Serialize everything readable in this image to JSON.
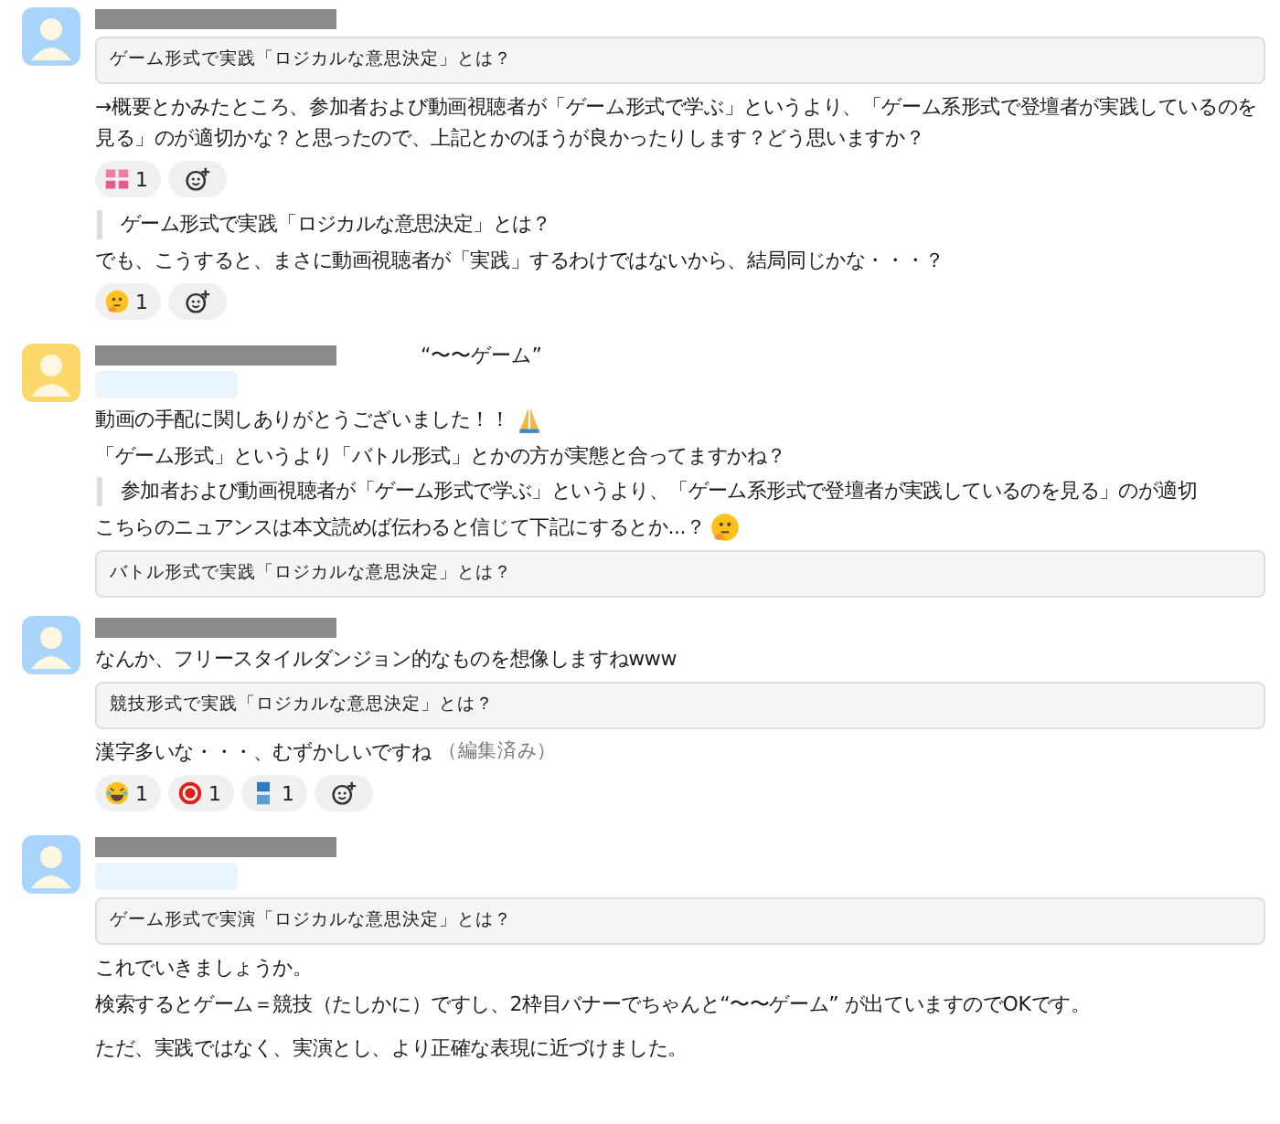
{
  "messages": [
    {
      "blocks": [
        {
          "kind": "card",
          "text": "ゲーム形式で実践「ロジカルな意思決定」とは？"
        },
        {
          "kind": "text",
          "text": "→概要とかみたところ、参加者および動画視聴者が「ゲーム形式で学ぶ」というより、「ゲーム系形式で登壇者が実践しているのを見る」のが適切かな？と思ったので、上記とかのほうが良かったりします？どう思いますか？"
        },
        {
          "kind": "reactions",
          "items": [
            {
              "count": "1"
            }
          ]
        },
        {
          "kind": "quote",
          "text": "ゲーム形式で実践「ロジカルな意思決定」とは？"
        },
        {
          "kind": "text",
          "text": "でも、こうすると、まさに動画視聴者が「実践」するわけではないから、結局同じかな・・・？"
        },
        {
          "kind": "reactions",
          "items": [
            {
              "count": "1"
            }
          ]
        }
      ]
    },
    {
      "note": "“〜〜ゲーム”",
      "blocks": [
        {
          "kind": "text",
          "text": "動画の手配に関しありがとうございました！！"
        },
        {
          "kind": "text",
          "text": "「ゲーム形式」というより「バトル形式」とかの方が実態と合ってますかね？"
        },
        {
          "kind": "quote",
          "text": "参加者および動画視聴者が「ゲーム形式で学ぶ」というより、「ゲーム系形式で登壇者が実践しているのを見る」のが適切"
        },
        {
          "kind": "text",
          "text": "こちらのニュアンスは本文読めば伝わると信じて下記にするとか...？"
        },
        {
          "kind": "card",
          "text": "バトル形式で実践「ロジカルな意思決定」とは？"
        }
      ]
    },
    {
      "blocks": [
        {
          "kind": "text",
          "text": "なんか、フリースタイルダンジョン的なものを想像しますねwww"
        },
        {
          "kind": "card",
          "text": "競技形式で実践「ロジカルな意思決定」とは？"
        },
        {
          "kind": "text",
          "text": "漢字多いな・・・、むずかしいですね",
          "edited": "（編集済み）"
        },
        {
          "kind": "reactions",
          "items": [
            {
              "count": "1"
            },
            {
              "count": "1"
            },
            {
              "count": "1"
            }
          ]
        }
      ]
    },
    {
      "blocks": [
        {
          "kind": "card",
          "text": "ゲーム形式で実演「ロジカルな意思決定」とは？"
        },
        {
          "kind": "text",
          "text": "これでいきましょうか。"
        },
        {
          "kind": "text",
          "text": "検索するとゲーム＝競技（たしかに）ですし、2枠目バナーでちゃんと“〜〜ゲーム” が出ていますのでOKです。"
        },
        {
          "kind": "text",
          "text": "ただ、実践ではなく、実演とし、より正確な表現に近づけました。"
        }
      ]
    }
  ]
}
